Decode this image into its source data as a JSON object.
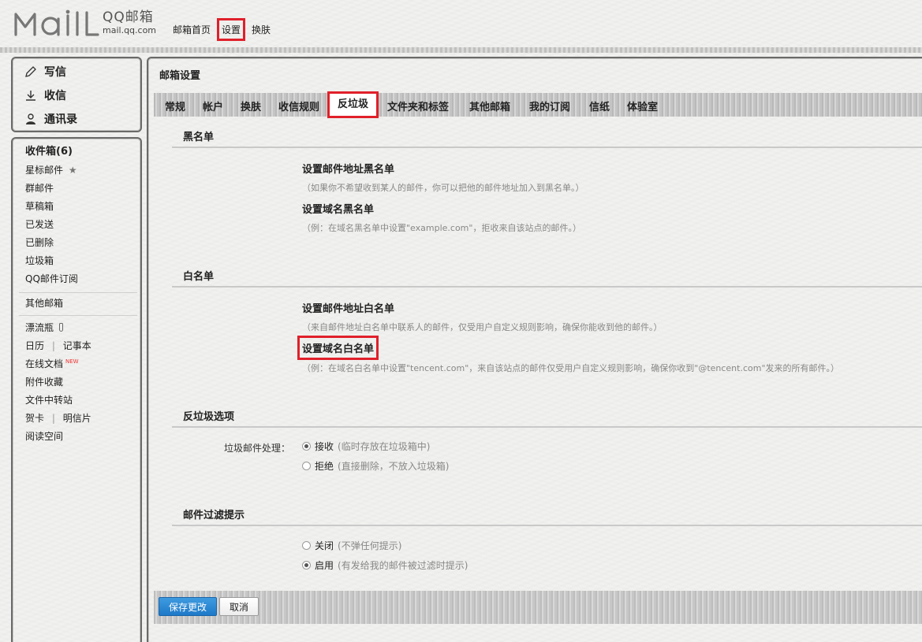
{
  "logo": {
    "mark": "MAIL",
    "name_cn": "QQ邮箱",
    "url": "mail.qq.com"
  },
  "topnav": {
    "home": "邮箱首页",
    "settings": "设置",
    "skin": "换肤"
  },
  "sidebar": {
    "quick": {
      "compose": "写信",
      "receive": "收信",
      "contacts": "通讯录"
    },
    "folders": {
      "inbox": "收件箱(6)",
      "starred": "星标邮件",
      "group": "群邮件",
      "drafts": "草稿箱",
      "sent": "已发送",
      "deleted": "已删除",
      "spam": "垃圾箱",
      "subscription": "QQ邮件订阅",
      "other_mailbox": "其他邮箱",
      "bottle": "漂流瓶",
      "calendar": "日历",
      "sep1": "|",
      "notes": "记事本",
      "docs": "在线文档",
      "docs_badge": "NEW",
      "attachments": "附件收藏",
      "file_transfer": "文件中转站",
      "cards": "贺卡",
      "sep2": "|",
      "postcards": "明信片",
      "reading": "阅读空间"
    }
  },
  "main": {
    "title": "邮箱设置",
    "tabs": [
      "常规",
      "帐户",
      "换肤",
      "收信规则",
      "反垃圾",
      "文件夹和标签",
      "其他邮箱",
      "我的订阅",
      "信纸",
      "体验室"
    ],
    "active_tab": "反垃圾",
    "blacklist": {
      "heading": "黑名单",
      "addr_title": "设置邮件地址黑名单",
      "addr_desc": "（如果你不希望收到某人的邮件，你可以把他的邮件地址加入到黑名单。）",
      "domain_title": "设置域名黑名单",
      "domain_desc": "（例：在域名黑名单中设置\"example.com\"，拒收来自该站点的邮件。）"
    },
    "whitelist": {
      "heading": "白名单",
      "addr_title": "设置邮件地址白名单",
      "addr_desc": "（来自邮件地址白名单中联系人的邮件，仅受用户自定义规则影响，确保你能收到他的邮件。）",
      "domain_title": "设置域名白名单",
      "domain_desc": "（例：在域名白名单中设置\"tencent.com\"，来自该站点的邮件仅受用户自定义规则影响，确保你收到\"@tencent.com\"发来的所有邮件。）"
    },
    "antispam": {
      "heading": "反垃圾选项",
      "label": "垃圾邮件处理：",
      "options": [
        {
          "label": "接收",
          "hint": "(临时存放在垃圾箱中)",
          "checked": true
        },
        {
          "label": "拒绝",
          "hint": "(直接删除，不放入垃圾箱)",
          "checked": false
        }
      ]
    },
    "filter_hint": {
      "heading": "邮件过滤提示",
      "options": [
        {
          "label": "关闭",
          "hint": "(不弹任何提示)",
          "checked": false
        },
        {
          "label": "启用",
          "hint": "(有发给我的邮件被过滤时提示)",
          "checked": true
        }
      ]
    },
    "buttons": {
      "save": "保存更改",
      "cancel": "取消"
    }
  },
  "colors": {
    "highlight": "#e0202a",
    "primary_button": "#1e79c8"
  },
  "icons": {
    "compose": "pencil-icon",
    "receive": "download-icon",
    "contacts": "contact-icon",
    "starred": "star-icon",
    "bottle": "bottle-icon"
  }
}
